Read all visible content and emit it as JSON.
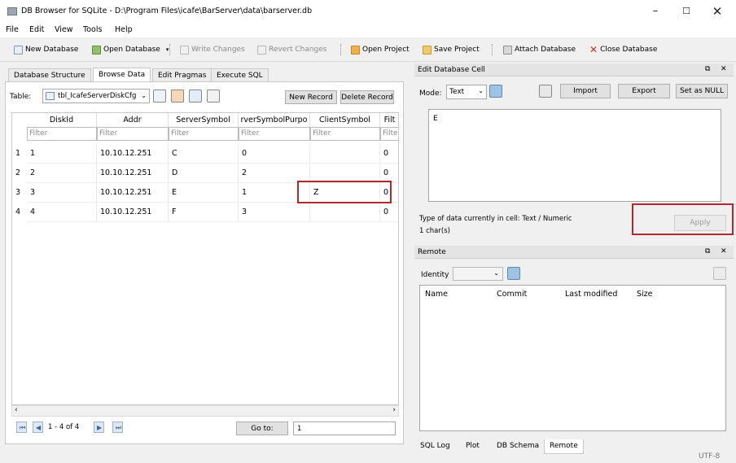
{
  "window": {
    "title": "DB Browser for SQLite - D:\\Program Files\\icafe\\BarServer\\data\\barserver.db",
    "min": "–",
    "max": "☐",
    "close": "✕"
  },
  "menu": [
    "File",
    "Edit",
    "View",
    "Tools",
    "Help"
  ],
  "toolbar": {
    "new_database": "New Database",
    "open_database": "Open Database",
    "write_changes": "Write Changes",
    "revert_changes": "Revert Changes",
    "open_project": "Open Project",
    "save_project": "Save Project",
    "attach_database": "Attach Database",
    "close_database": "Close Database"
  },
  "tabs": [
    "Database Structure",
    "Browse Data",
    "Edit Pragmas",
    "Execute SQL"
  ],
  "active_tab": "Browse Data",
  "browse": {
    "table_label": "Table:",
    "table_value": "tbl_IcafeServerDiskCfg",
    "new_record": "New Record",
    "delete_record": "Delete Record",
    "columns": [
      "DiskId",
      "Addr",
      "ServerSymbol",
      "rverSymbolPurpo",
      "ClientSymbol",
      "Filt"
    ],
    "filter_placeholder": "Filter",
    "rows": [
      {
        "num": "1",
        "cells": [
          "1",
          "10.10.12.251",
          "C",
          "0",
          "",
          "0"
        ]
      },
      {
        "num": "2",
        "cells": [
          "2",
          "10.10.12.251",
          "D",
          "2",
          "",
          "0"
        ]
      },
      {
        "num": "3",
        "cells": [
          "3",
          "10.10.12.251",
          "E",
          "1",
          "Z",
          "0"
        ]
      },
      {
        "num": "4",
        "cells": [
          "4",
          "10.10.12.251",
          "F",
          "3",
          "",
          "0"
        ]
      }
    ],
    "record_count": "1 - 4 of 4",
    "goto_label": "Go to:",
    "goto_value": "1"
  },
  "edit_cell": {
    "title": "Edit Database Cell",
    "mode_label": "Mode:",
    "mode_value": "Text",
    "import": "Import",
    "export": "Export",
    "set_null": "Set as NULL",
    "content": "E",
    "type_info": "Type of data currently in cell: Text / Numeric",
    "size_info": "1 char(s)",
    "apply": "Apply"
  },
  "remote": {
    "title": "Remote",
    "identity_label": "Identity",
    "columns": [
      "Name",
      "Commit",
      "Last modified",
      "Size"
    ]
  },
  "bottom_tabs": [
    "SQL Log",
    "Plot",
    "DB Schema",
    "Remote"
  ],
  "active_bottom_tab": "Remote",
  "status_encoding": "UTF-8"
}
